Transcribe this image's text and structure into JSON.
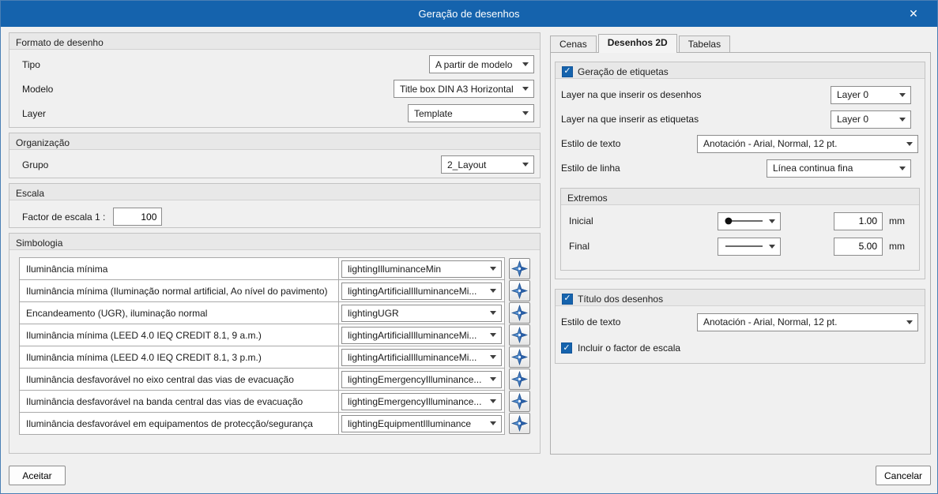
{
  "colors": {
    "titlebar": "#1563ad",
    "accent": "#1563ad"
  },
  "icons": {
    "check": "✓",
    "close": "✕"
  },
  "dialog": {
    "title": "Geração de desenhos"
  },
  "left": {
    "formato": {
      "title": "Formato de desenho",
      "fields": [
        {
          "label": "Tipo",
          "value": "A partir de modelo"
        },
        {
          "label": "Modelo",
          "value": "Title box DIN A3 Horizontal"
        },
        {
          "label": "Layer",
          "value": "Template"
        }
      ]
    },
    "organizacao": {
      "title": "Organização",
      "fields": [
        {
          "label": "Grupo",
          "value": "2_Layout"
        }
      ]
    },
    "escala": {
      "title": "Escala",
      "factor_label": "Factor de escala 1 :",
      "factor_value": "100"
    },
    "simbologia": {
      "title": "Simbologia",
      "rows": [
        {
          "label": "Iluminância mínima",
          "value": "lightingIlluminanceMin"
        },
        {
          "label": "Iluminância mínima (Iluminação normal artificial, Ao nível do pavimento)",
          "value": "lightingArtificialIlluminanceMi..."
        },
        {
          "label": "Encandeamento (UGR), iluminação normal",
          "value": "lightingUGR"
        },
        {
          "label": "Iluminância mínima (LEED 4.0 IEQ CREDIT 8.1, 9 a.m.)",
          "value": "lightingArtificialIlluminanceMi..."
        },
        {
          "label": "Iluminância mínima (LEED 4.0 IEQ CREDIT 8.1, 3 p.m.)",
          "value": "lightingArtificialIlluminanceMi..."
        },
        {
          "label": "Iluminância desfavorável no eixo central das vias de evacuação",
          "value": "lightingEmergencyIlluminance..."
        },
        {
          "label": "Iluminância desfavorável na banda central das vias de evacuação",
          "value": "lightingEmergencyIlluminance..."
        },
        {
          "label": "Iluminância desfavorável em equipamentos de protecção/segurança",
          "value": "lightingEquipmentIlluminance"
        }
      ]
    }
  },
  "right": {
    "tabs": [
      {
        "label": "Cenas"
      },
      {
        "label": "Desenhos 2D"
      },
      {
        "label": "Tabelas"
      }
    ],
    "etiquetas": {
      "title": "Geração de etiquetas",
      "checked": true,
      "fields": [
        {
          "label": "Layer na que inserir os desenhos",
          "value": "Layer 0"
        },
        {
          "label": "Layer na que inserir as etiquetas",
          "value": "Layer 0"
        },
        {
          "label": "Estilo de texto",
          "value": "Anotación - Arial, Normal, 12 pt."
        },
        {
          "label": "Estilo de linha",
          "value": "Línea continua fina"
        }
      ],
      "extremos": {
        "title": "Extremos",
        "rows": [
          {
            "label": "Inicial",
            "value": "1.00",
            "unit": "mm"
          },
          {
            "label": "Final",
            "value": "5.00",
            "unit": "mm"
          }
        ]
      }
    },
    "titulo": {
      "title": "Título dos desenhos",
      "checked": true,
      "estilo_label": "Estilo de texto",
      "estilo_value": "Anotación - Arial, Normal, 12 pt.",
      "incluir_label": "Incluir o factor de escala",
      "incluir_checked": true
    }
  },
  "footer": {
    "accept_label": "Aceitar",
    "cancel_label": "Cancelar"
  }
}
